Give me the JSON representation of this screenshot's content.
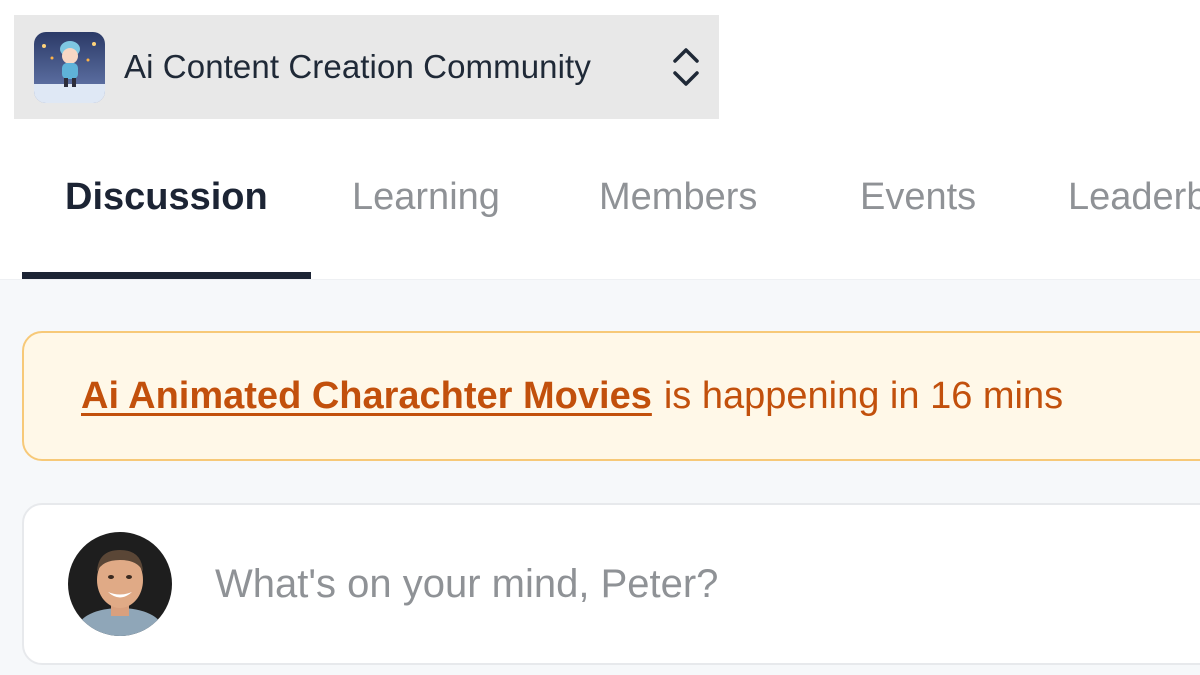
{
  "community": {
    "name": "Ai Content Creation Community",
    "logo_icon": "ice-skater-character-icon",
    "switch_icon": "chevron-up-down-icon"
  },
  "tabs": [
    {
      "label": "Discussion",
      "active": true
    },
    {
      "label": "Learning",
      "active": false
    },
    {
      "label": "Members",
      "active": false
    },
    {
      "label": "Events",
      "active": false
    },
    {
      "label": "Leaderboards",
      "active": false
    }
  ],
  "event_banner": {
    "event_title": "Ai Animated Charachter Movies",
    "suffix": "is happening in 16 mins"
  },
  "composer": {
    "placeholder": "What's on your mind, Peter?",
    "value": "",
    "avatar_icon": "user-avatar-photo"
  },
  "colors": {
    "active_tab": "#1c2434",
    "inactive_tab": "#8f9296",
    "banner_text": "#c2500c",
    "banner_bg": "#fff8e8",
    "banner_border": "#f7c978"
  }
}
